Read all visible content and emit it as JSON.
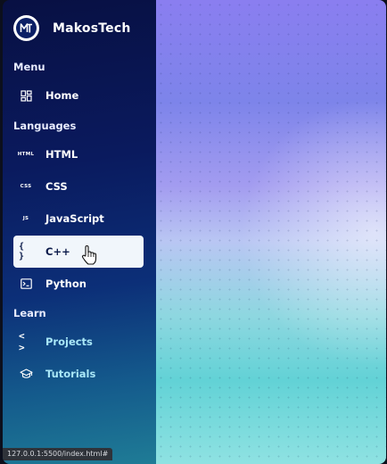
{
  "brand": {
    "name": "MakosTech",
    "logo_text": "MT"
  },
  "sections": {
    "menu": "Menu",
    "languages": "Languages",
    "learn": "Learn"
  },
  "nav": {
    "home": {
      "label": "Home",
      "icon": "grid-icon"
    },
    "html": {
      "label": "HTML",
      "icon_text": "HTML"
    },
    "css": {
      "label": "CSS",
      "icon_text": "CSS"
    },
    "javascript": {
      "label": "JavaScript",
      "icon_text": "JS"
    },
    "cpp": {
      "label": "C++",
      "icon_text": "{ }"
    },
    "python": {
      "label": "Python",
      "icon": "terminal-icon"
    },
    "projects": {
      "label": "Projects",
      "icon_text": "< >"
    },
    "tutorials": {
      "label": "Tutorials",
      "icon": "graduation-cap-icon"
    }
  },
  "status_bar": {
    "url": "127.0.0.1:5500/index.html#"
  },
  "colors": {
    "sidebar_top": "#081043",
    "sidebar_bottom": "#1f7c96",
    "active_item_bg": "#f1f6fb",
    "accent_text": "#a9e7f7"
  }
}
